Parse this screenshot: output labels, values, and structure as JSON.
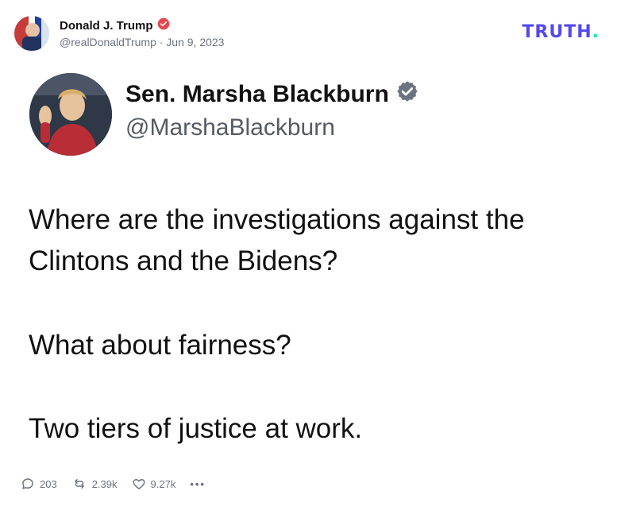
{
  "post": {
    "author_name": "Donald J. Trump",
    "author_meta": "@realDonaldTrump · Jun 9, 2023",
    "verified_icon": "verified-badge-icon",
    "brand": {
      "text": "TRUTH",
      "dot": "."
    }
  },
  "quoted": {
    "name": "Sen. Marsha Blackburn",
    "handle": "@MarshaBlackburn",
    "paragraphs": [
      "Where are the investigations against the Clintons and the Bidens?",
      "What about fairness?",
      "Two tiers of justice at work."
    ]
  },
  "actions": {
    "replies": "203",
    "retruths": "2.39k",
    "likes": "9.27k",
    "more": "•••"
  },
  "colors": {
    "brand": "#5448ee",
    "brand_dot": "#17e6b8",
    "verified_red": "#e5484d",
    "verified_gray": "#6b7280",
    "muted": "#6b7280"
  }
}
